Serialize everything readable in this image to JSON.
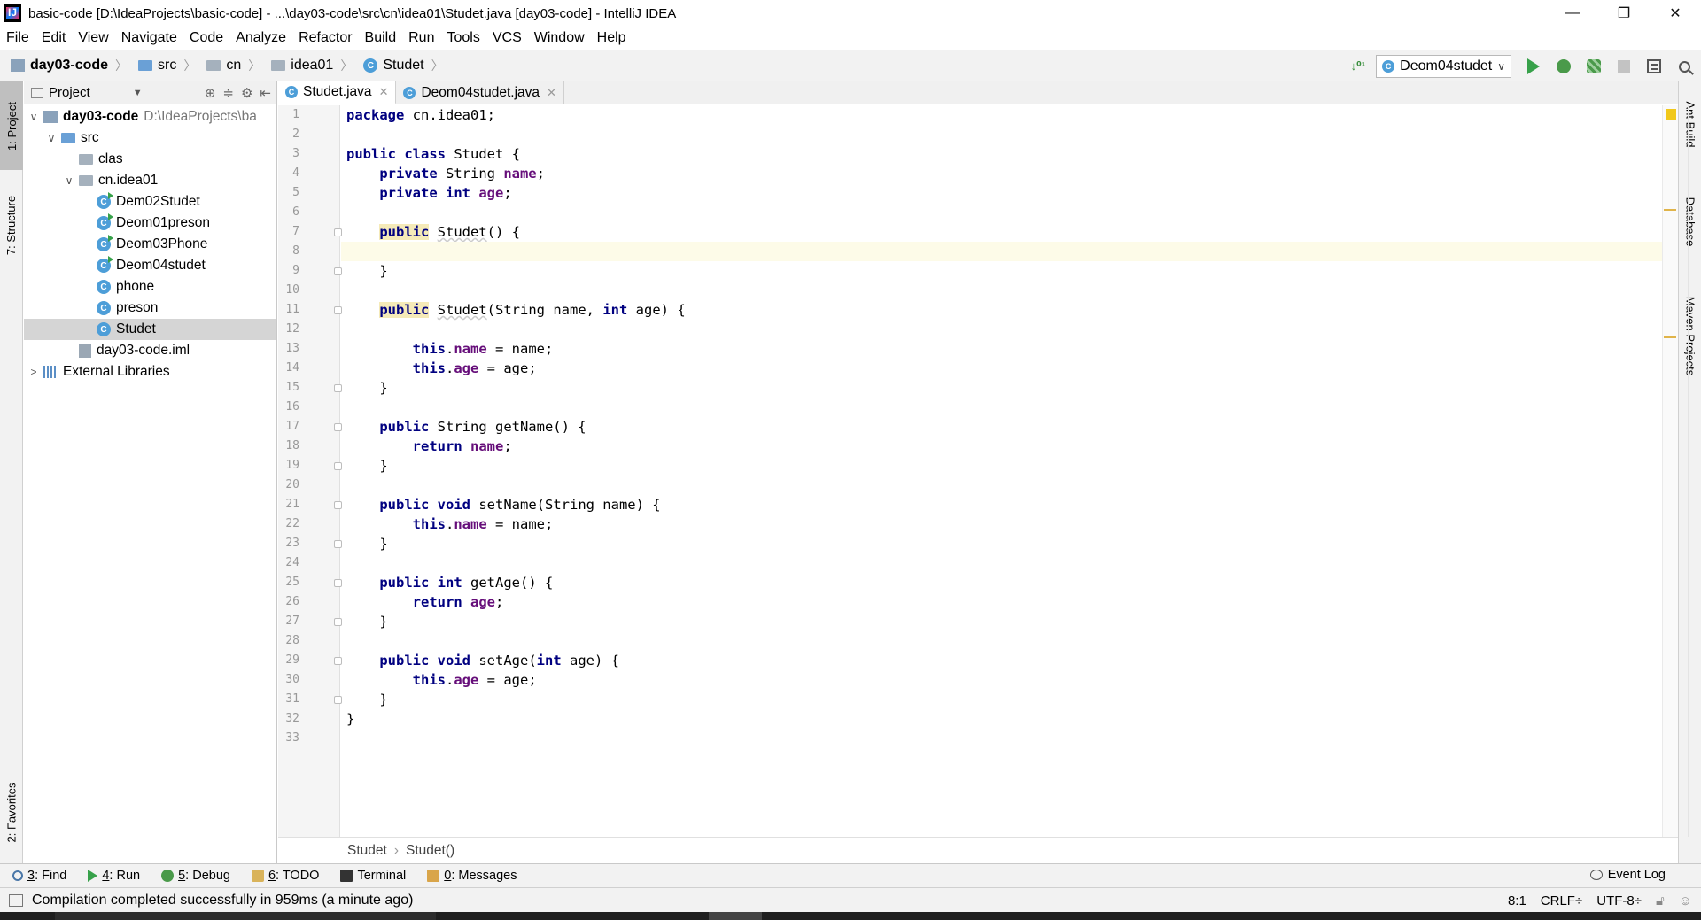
{
  "window": {
    "title": "basic-code [D:\\IdeaProjects\\basic-code] - ...\\day03-code\\src\\cn\\idea01\\Studet.java [day03-code] - IntelliJ IDEA",
    "app_icon_letter": "IJ",
    "minimize": "—",
    "restore": "❐",
    "close": "✕"
  },
  "menu": [
    "File",
    "Edit",
    "View",
    "Navigate",
    "Code",
    "Analyze",
    "Refactor",
    "Build",
    "Run",
    "Tools",
    "VCS",
    "Window",
    "Help"
  ],
  "navbar": {
    "crumbs": [
      "day03-code",
      "src",
      "cn",
      "idea01",
      "Studet"
    ],
    "run_config": "Deom04studet",
    "sort_glyph": "↓⁰¹"
  },
  "left_strip": {
    "tabs": [
      "1: Project",
      "7: Structure",
      "2: Favorites"
    ]
  },
  "right_strip": {
    "tabs": [
      "Ant Build",
      "Database",
      "Maven Projects"
    ]
  },
  "project_panel": {
    "title": "Project",
    "tools": [
      "⊕",
      "≑",
      "⚙",
      "⇤"
    ],
    "tree": [
      {
        "label": "day03-code",
        "extra": "D:\\IdeaProjects\\ba",
        "icon": "project-folder-icon",
        "arrow": "∨",
        "indent": 0
      },
      {
        "label": "src",
        "icon": "source-folder-icon",
        "arrow": "∨",
        "indent": 1
      },
      {
        "label": "clas",
        "icon": "folder-icon",
        "arrow": "",
        "indent": 2
      },
      {
        "label": "cn.idea01",
        "icon": "package-icon",
        "arrow": "∨",
        "indent": 2
      },
      {
        "label": "Dem02Studet",
        "icon": "runnable-class-icon",
        "arrow": "",
        "indent": 3
      },
      {
        "label": "Deom01preson",
        "icon": "runnable-class-icon",
        "arrow": "",
        "indent": 3
      },
      {
        "label": "Deom03Phone",
        "icon": "runnable-class-icon",
        "arrow": "",
        "indent": 3
      },
      {
        "label": "Deom04studet",
        "icon": "runnable-class-icon",
        "arrow": "",
        "indent": 3
      },
      {
        "label": "phone",
        "icon": "class-icon",
        "arrow": "",
        "indent": 3
      },
      {
        "label": "preson",
        "icon": "class-icon",
        "arrow": "",
        "indent": 3
      },
      {
        "label": "Studet",
        "icon": "class-icon",
        "arrow": "",
        "indent": 3,
        "selected": true
      },
      {
        "label": "day03-code.iml",
        "icon": "iml-file-icon",
        "arrow": "",
        "indent": 2
      },
      {
        "label": "External Libraries",
        "icon": "libraries-icon",
        "arrow": ">",
        "indent": 0
      }
    ]
  },
  "editor": {
    "tabs": [
      {
        "label": "Studet.java",
        "active": true
      },
      {
        "label": "Deom04studet.java",
        "active": false
      }
    ],
    "current_line": 8,
    "lines": [
      "package cn.idea01;",
      "",
      "public class Studet {",
      "    private String name;",
      "    private int age;",
      "",
      "    public Studet() {",
      "",
      "    }",
      "",
      "    public Studet(String name, int age) {",
      "",
      "        this.name = name;",
      "        this.age = age;",
      "    }",
      "",
      "    public String getName() {",
      "        return name;",
      "    }",
      "",
      "    public void setName(String name) {",
      "        this.name = name;",
      "    }",
      "",
      "    public int getAge() {",
      "        return age;",
      "    }",
      "",
      "    public void setAge(int age) {",
      "        this.age = age;",
      "    }",
      "}",
      ""
    ],
    "fold_lines": [
      7,
      9,
      11,
      15,
      17,
      19,
      21,
      23,
      25,
      27,
      29,
      31
    ],
    "breadcrumb": [
      "Studet",
      "Studet()"
    ]
  },
  "bottom_tools": [
    {
      "key": "3",
      "label": ": Find",
      "icon": "search-icon"
    },
    {
      "key": "4",
      "label": ": Run",
      "icon": "run-icon"
    },
    {
      "key": "5",
      "label": ": Debug",
      "icon": "debug-icon"
    },
    {
      "key": "6",
      "label": ": TODO",
      "icon": "todo-icon"
    },
    {
      "key": "",
      "label": "Terminal",
      "icon": "terminal-icon"
    },
    {
      "key": "0",
      "label": ": Messages",
      "icon": "messages-icon"
    }
  ],
  "event_log": "Event Log",
  "status": {
    "message": "Compilation completed successfully in 959ms (a minute ago)",
    "position": "8:1",
    "line_sep": "CRLF÷",
    "encoding": "UTF-8÷"
  }
}
